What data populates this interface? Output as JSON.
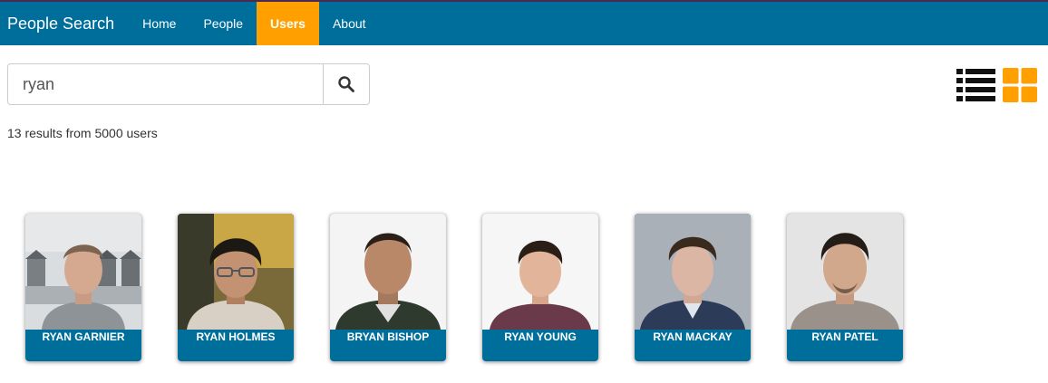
{
  "navbar": {
    "brand": "People Search",
    "items": [
      {
        "label": "Home",
        "active": false
      },
      {
        "label": "People",
        "active": false
      },
      {
        "label": "Users",
        "active": true
      },
      {
        "label": "About",
        "active": false
      }
    ]
  },
  "search": {
    "value": "ryan",
    "button_icon": "search-icon"
  },
  "results_text": "13 results from 5000 users",
  "view_toggles": {
    "list_icon": "list-view-icon",
    "grid_icon": "grid-view-icon",
    "active": "grid"
  },
  "users": [
    {
      "name": "RYAN GARNIER"
    },
    {
      "name": "RYAN HOLMES"
    },
    {
      "name": "BRYAN BISHOP"
    },
    {
      "name": "RYAN YOUNG"
    },
    {
      "name": "RYAN MACKAY"
    },
    {
      "name": "RYAN PATEL"
    }
  ],
  "colors": {
    "navbar": "#006e9b",
    "accent": "#ff9f00",
    "card_label": "#006e9b"
  }
}
